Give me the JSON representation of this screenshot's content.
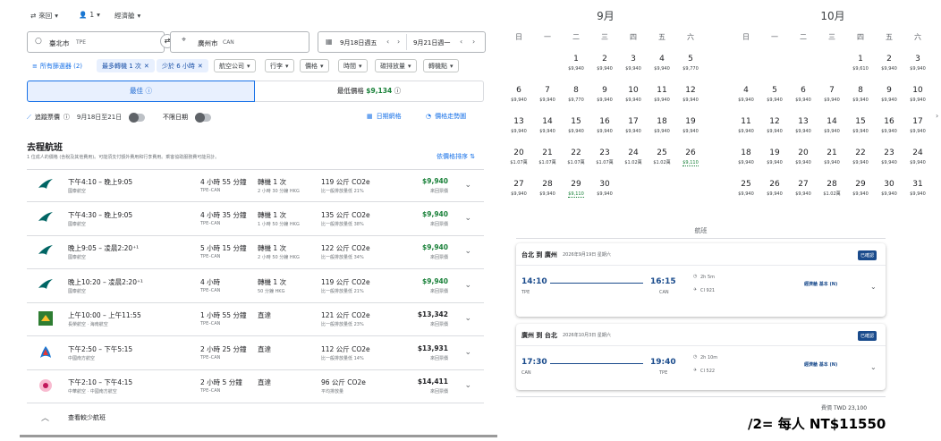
{
  "search": {
    "trip": "來回",
    "pax": "1",
    "cabin": "經濟艙",
    "origin": "臺北市",
    "origin_code": "TPE",
    "dest": "廣州市",
    "dest_code": "CAN",
    "dep": "9月18日週五",
    "ret": "9月21日週一"
  },
  "filters": {
    "all": "所有篩選器 (2)",
    "stops": "最多轉機 1 次",
    "duration": "少於 6 小時",
    "airline": "航空公司",
    "bags": "行李",
    "price": "價格",
    "times": "時間",
    "emissions": "碳排放量",
    "connecting": "轉機點"
  },
  "tabs": {
    "best": "最佳",
    "cheapest_label": "最低價格",
    "cheapest_price": "$9,134"
  },
  "tools": {
    "track": "追蹤票價",
    "track_dates": "9月18日至21日",
    "any_dates": "不限日期",
    "date_grid": "日期網格",
    "price_graph": "價格走勢圖"
  },
  "section": {
    "title": "去程航班",
    "note": "1 位成人的價格 (含稅及其他費用)。可能須支付額外費用和行李費用。乘客協助服務費可能另計。",
    "sort": "依價格排序"
  },
  "flights": [
    {
      "time": "下午4:10 – 晚上9:05",
      "airline": "國泰航空",
      "duration": "4 小時 55 分鐘",
      "route": "TPE–CAN",
      "stops": "轉機 1 次",
      "stop_detail": "2 小時 30 分鐘 HKG",
      "co2": "119 公斤 CO2e",
      "co2_detail": "比一般排放量低 21%",
      "price": "$9,940",
      "price_note": "來回票價",
      "logo": "cx",
      "green": true
    },
    {
      "time": "下午4:30 – 晚上9:05",
      "airline": "國泰航空",
      "duration": "4 小時 35 分鐘",
      "route": "TPE–CAN",
      "stops": "轉機 1 次",
      "stop_detail": "1 小時 50 分鐘 HKG",
      "co2": "135 公斤 CO2e",
      "co2_detail": "比一般排放量低 38%",
      "price": "$9,940",
      "price_note": "來回票價",
      "logo": "cx",
      "green": true
    },
    {
      "time": "晚上9:05 – 凌晨2:20⁺¹",
      "airline": "國泰航空",
      "duration": "5 小時 15 分鐘",
      "route": "TPE–CAN",
      "stops": "轉機 1 次",
      "stop_detail": "2 小時 50 分鐘 HKG",
      "co2": "122 公斤 CO2e",
      "co2_detail": "比一般排放量低 34%",
      "price": "$9,940",
      "price_note": "來回票價",
      "logo": "cx",
      "green": true
    },
    {
      "time": "晚上10:20 – 凌晨2:20⁺¹",
      "airline": "國泰航空",
      "duration": "4 小時",
      "route": "TPE–CAN",
      "stops": "轉機 1 次",
      "stop_detail": "50 分鐘 HKG",
      "co2": "119 公斤 CO2e",
      "co2_detail": "比一般排放量低 21%",
      "price": "$9,940",
      "price_note": "來回票價",
      "logo": "cx",
      "green": true
    },
    {
      "time": "上午10:00 – 上午11:55",
      "airline": "長榮航空 · 海南航空",
      "duration": "1 小時 55 分鐘",
      "route": "TPE–CAN",
      "stops": "直達",
      "stop_detail": "",
      "co2": "121 公斤 CO2e",
      "co2_detail": "比一般排放量低 23%",
      "price": "$13,342",
      "price_note": "來回票價",
      "logo": "br",
      "green": false
    },
    {
      "time": "下午2:50 – 下午5:15",
      "airline": "中國南方航空",
      "duration": "2 小時 25 分鐘",
      "route": "TPE–CAN",
      "stops": "直達",
      "stop_detail": "",
      "co2": "112 公斤 CO2e",
      "co2_detail": "比一般排放量低 14%",
      "price": "$13,931",
      "price_note": "來回票價",
      "logo": "cz",
      "green": false
    },
    {
      "time": "下午2:10 – 下午4:15",
      "airline": "中華航空 · 中國南方航空",
      "duration": "2 小時 5 分鐘",
      "route": "TPE–CAN",
      "stops": "直達",
      "stop_detail": "",
      "co2": "96 公斤 CO2e",
      "co2_detail": "平均排放量",
      "price": "$14,411",
      "price_note": "來回票價",
      "logo": "ci",
      "green": false
    }
  ],
  "fewer": "查看較少航班",
  "calendar": {
    "months": [
      "9月",
      "10月"
    ],
    "weekdays": [
      "日",
      "一",
      "二",
      "三",
      "四",
      "五",
      "六"
    ],
    "sep": [
      [
        null,
        null,
        {
          "d": "1",
          "p": "$9,940"
        },
        {
          "d": "2",
          "p": "$9,940"
        },
        {
          "d": "3",
          "p": "$9,940"
        },
        {
          "d": "4",
          "p": "$9,940"
        },
        {
          "d": "5",
          "p": "$9,770"
        }
      ],
      [
        {
          "d": "6",
          "p": "$9,940"
        },
        {
          "d": "7",
          "p": "$9,940"
        },
        {
          "d": "8",
          "p": "$9,770"
        },
        {
          "d": "9",
          "p": "$9,940"
        },
        {
          "d": "10",
          "p": "$9,940"
        },
        {
          "d": "11",
          "p": "$9,940"
        },
        {
          "d": "12",
          "p": "$9,940"
        }
      ],
      [
        {
          "d": "13",
          "p": "$9,940"
        },
        {
          "d": "14",
          "p": "$9,940"
        },
        {
          "d": "15",
          "p": "$9,940"
        },
        {
          "d": "16",
          "p": "$9,940"
        },
        {
          "d": "17",
          "p": "$9,940"
        },
        {
          "d": "18",
          "p": "$9,940"
        },
        {
          "d": "19",
          "p": "$9,940"
        }
      ],
      [
        {
          "d": "20",
          "p": "$1.07萬"
        },
        {
          "d": "21",
          "p": "$1.07萬"
        },
        {
          "d": "22",
          "p": "$1.07萬"
        },
        {
          "d": "23",
          "p": "$1.07萬"
        },
        {
          "d": "24",
          "p": "$1.02萬"
        },
        {
          "d": "25",
          "p": "$1.02萬"
        },
        {
          "d": "26",
          "p": "$9,110",
          "g": true
        }
      ],
      [
        {
          "d": "27",
          "p": "$9,940"
        },
        {
          "d": "28",
          "p": "$9,940"
        },
        {
          "d": "29",
          "p": "$9,110",
          "g": true
        },
        {
          "d": "30",
          "p": "$9,940"
        },
        null,
        null,
        null
      ]
    ],
    "oct": [
      [
        null,
        null,
        null,
        null,
        {
          "d": "1",
          "p": "$9,610"
        },
        {
          "d": "2",
          "p": "$9,940"
        },
        {
          "d": "3",
          "p": "$9,940"
        }
      ],
      [
        {
          "d": "4",
          "p": "$9,940"
        },
        {
          "d": "5",
          "p": "$9,940"
        },
        {
          "d": "6",
          "p": "$9,940"
        },
        {
          "d": "7",
          "p": "$9,940"
        },
        {
          "d": "8",
          "p": "$9,940"
        },
        {
          "d": "9",
          "p": "$9,940"
        },
        {
          "d": "10",
          "p": "$9,940"
        }
      ],
      [
        {
          "d": "11",
          "p": "$9,940"
        },
        {
          "d": "12",
          "p": "$9,940"
        },
        {
          "d": "13",
          "p": "$9,940"
        },
        {
          "d": "14",
          "p": "$9,940"
        },
        {
          "d": "15",
          "p": "$9,940"
        },
        {
          "d": "16",
          "p": "$9,940"
        },
        {
          "d": "17",
          "p": "$9,940"
        }
      ],
      [
        {
          "d": "18",
          "p": "$9,940"
        },
        {
          "d": "19",
          "p": "$9,940"
        },
        {
          "d": "20",
          "p": "$9,940"
        },
        {
          "d": "21",
          "p": "$9,940"
        },
        {
          "d": "22",
          "p": "$9,940"
        },
        {
          "d": "23",
          "p": "$9,940"
        },
        {
          "d": "24",
          "p": "$9,940"
        }
      ],
      [
        {
          "d": "25",
          "p": "$9,940"
        },
        {
          "d": "26",
          "p": "$9,940"
        },
        {
          "d": "27",
          "p": "$9,940"
        },
        {
          "d": "28",
          "p": "$1.02萬"
        },
        {
          "d": "29",
          "p": "$9,940"
        },
        {
          "d": "30",
          "p": "$9,940"
        },
        {
          "d": "31",
          "p": "$9,940"
        }
      ]
    ]
  },
  "booking": {
    "header": "航班",
    "out": {
      "title": "台北 到 廣州",
      "date": "2026年9月19日 星期六",
      "badge": "已確認",
      "dep_time": "14:10",
      "dep_code": "TPE",
      "arr_time": "16:15",
      "arr_code": "CAN",
      "dur": "2h 5m",
      "flight": "CI 921",
      "cabin": "經濟艙 基本 (N)"
    },
    "ret": {
      "title": "廣州 到 台北",
      "date": "2026年10月3日 星期六",
      "badge": "已確認",
      "dep_time": "17:30",
      "dep_code": "CAN",
      "arr_time": "19:40",
      "arr_code": "TPE",
      "dur": "2h 10m",
      "flight": "CI 522",
      "cabin": "經濟艙 基本 (N)"
    },
    "total": "TWD 23,100",
    "total_label": "費價"
  },
  "note": "/2= 每人 NT$11550",
  "colors": {
    "blue": "#1a73e8",
    "green": "#188038",
    "cx": "#006564",
    "dark": "#202124"
  }
}
